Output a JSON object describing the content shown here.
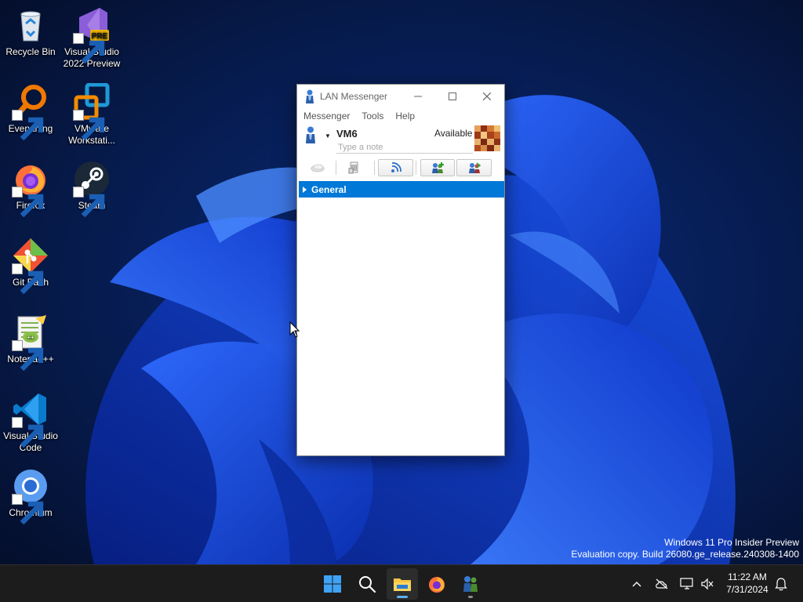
{
  "desktop": {
    "icons": [
      {
        "label": "Recycle Bin"
      },
      {
        "label": "Visual Studio 2022 Preview",
        "badge": "PRE"
      },
      {
        "label": "Everything"
      },
      {
        "label": "VMware Workstati..."
      },
      {
        "label": "Firefox"
      },
      {
        "label": "Steam"
      },
      {
        "label": "Git Bash"
      },
      {
        "label": "Notepad++"
      },
      {
        "label": "Visual Studio Code"
      },
      {
        "label": "Chromium"
      }
    ],
    "watermark": {
      "line1": "Windows 11 Pro Insider Preview",
      "line2": "Evaluation copy. Build 26080.ge_release.240308-1400"
    }
  },
  "window": {
    "title": "LAN Messenger",
    "menu": [
      "Messenger",
      "Tools",
      "Help"
    ],
    "user": {
      "name": "VM6",
      "status": "Available",
      "note_placeholder": "Type a note"
    },
    "toolbar_icons": [
      "chat-icon",
      "file-transfer-icon",
      "broadcast-icon",
      "add-contact-icon",
      "refresh-contacts-icon"
    ],
    "groups": [
      {
        "label": "General"
      }
    ]
  },
  "taskbar": {
    "apps": [
      "start-icon",
      "search-icon",
      "file-explorer-icon",
      "firefox-icon",
      "lan-messenger-icon"
    ],
    "clock": {
      "time": "11:22 AM",
      "date": "7/31/2024"
    }
  },
  "colors": {
    "accent": "#0078d7",
    "taskbar": "#1c1c1c",
    "desktop_bg": "#06122e"
  }
}
